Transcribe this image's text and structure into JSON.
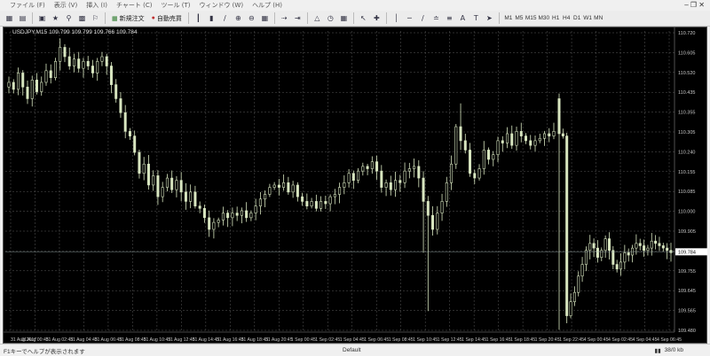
{
  "menu": {
    "items": [
      "ファイル (F)",
      "表示 (V)",
      "挿入 (I)",
      "チャート (C)",
      "ツール (T)",
      "ウィンドウ (W)",
      "ヘルプ (H)"
    ]
  },
  "toolbar": {
    "new_order": "新規注文",
    "auto_trading": "自動売買",
    "timeframes": [
      "M1",
      "M5",
      "M15",
      "M30",
      "H1",
      "H4",
      "D1",
      "W1",
      "MN"
    ]
  },
  "chart": {
    "header": "USDJPY,M15  109.799 109.799 109.766 109.784",
    "current_price": "109.784",
    "colors": {
      "background": "#000000",
      "grid": "#5a5a5a",
      "candle": "#d8e6c0",
      "axis_text": "#c8c8c8"
    }
  },
  "chart_data": {
    "type": "candlestick",
    "symbol": "USDJPY",
    "timeframe": "M15",
    "ylim": [
      109.44,
      110.73
    ],
    "y_ticks": [
      "110.720",
      "110.605",
      "110.520",
      "110.435",
      "110.355",
      "110.305",
      "110.240",
      "110.155",
      "110.085",
      "110.000",
      "109.905",
      "109.820",
      "109.755",
      "109.645",
      "109.565",
      "109.480"
    ],
    "x_ticks": [
      "31 Aug 2017",
      "31 Aug 00:45",
      "31 Aug 02:45",
      "31 Aug 04:45",
      "31 Aug 06:45",
      "31 Aug 08:45",
      "31 Aug 10:45",
      "31 Aug 12:45",
      "31 Aug 14:45",
      "31 Aug 16:45",
      "31 Aug 18:45",
      "31 Aug 20:45",
      "1 Sep 00:45",
      "1 Sep 02:45",
      "1 Sep 04:45",
      "1 Sep 06:45",
      "1 Sep 08:45",
      "1 Sep 10:45",
      "1 Sep 12:45",
      "1 Sep 14:45",
      "1 Sep 16:45",
      "1 Sep 18:45",
      "1 Sep 20:45",
      "1 Sep 22:45",
      "4 Sep 00:45",
      "4 Sep 02:45",
      "4 Sep 04:45",
      "4 Sep 06:45"
    ],
    "close": [
      110.51,
      110.48,
      110.55,
      110.49,
      110.44,
      110.52,
      110.47,
      110.51,
      110.56,
      110.53,
      110.6,
      110.66,
      110.62,
      110.58,
      110.61,
      110.57,
      110.6,
      110.58,
      110.55,
      110.6,
      110.62,
      110.58,
      110.5,
      110.44,
      110.38,
      110.3,
      110.28,
      110.21,
      110.12,
      110.16,
      110.07,
      110.11,
      110.02,
      110.06,
      110.1,
      110.05,
      110.09,
      110.04,
      110.0,
      110.04,
      109.98,
      109.97,
      109.93,
      109.88,
      109.91,
      109.92,
      109.95,
      109.93,
      109.95,
      109.94,
      109.96,
      109.93,
      109.95,
      109.98,
      110.01,
      110.03,
      110.06,
      110.07,
      110.06,
      110.08,
      110.04,
      110.07,
      110.02,
      110.0,
      109.98,
      110.0,
      109.97,
      110.0,
      109.99,
      110.02,
      110.03,
      110.06,
      110.08,
      110.12,
      110.09,
      110.13,
      110.15,
      110.14,
      110.17,
      110.13,
      110.06,
      110.08,
      110.05,
      110.09,
      110.08,
      110.13,
      110.14,
      110.15,
      110.1,
      110.0,
      109.94,
      109.88,
      109.95,
      110.0,
      110.08,
      110.16,
      110.32,
      110.26,
      110.22,
      110.12,
      110.1,
      110.14,
      110.22,
      110.18,
      110.2,
      110.26,
      110.25,
      110.29,
      110.24,
      110.3,
      110.28,
      110.26,
      110.24,
      110.26,
      110.27,
      110.29,
      110.28,
      110.3,
      110.29,
      110.28,
      109.51,
      109.57,
      109.61,
      109.68,
      109.73,
      109.79,
      109.82,
      109.8,
      109.76,
      109.79,
      109.84,
      109.79,
      109.73,
      109.71,
      109.74,
      109.78,
      109.77,
      109.8,
      109.82,
      109.81,
      109.79,
      109.8,
      109.83,
      109.82,
      109.81,
      109.8,
      109.79,
      109.78
    ]
  },
  "status": {
    "help": "F1キーでヘルプが表示されます",
    "profile": "Default",
    "traffic": "38/0 kb"
  },
  "icons": [
    "new-chart-icon",
    "profiles-icon",
    "window-icon",
    "navigator-icon",
    "search-icon",
    "terminal-icon",
    "tester-icon",
    "order-icon",
    "autotrade-icon",
    "bars-icon",
    "candles-icon",
    "line-icon",
    "zoom-in-icon",
    "zoom-out-icon",
    "tile-icon",
    "scroll-icon",
    "shift-icon",
    "indicators-icon",
    "periods-icon",
    "templates-icon",
    "cursor-icon",
    "crosshair-icon",
    "vline-icon",
    "hline-icon",
    "trendline-icon",
    "channel-icon",
    "fibo-icon",
    "text-icon",
    "label-icon",
    "arrows-icon"
  ]
}
